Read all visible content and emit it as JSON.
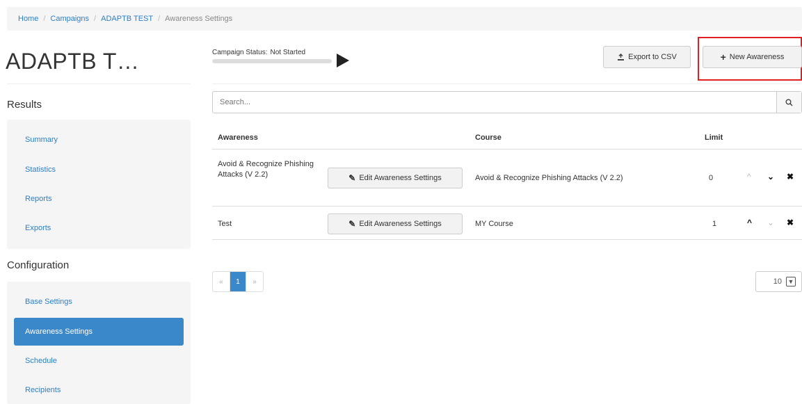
{
  "breadcrumb": {
    "home": "Home",
    "campaigns": "Campaigns",
    "campaign": "ADAPTB TEST",
    "current": "Awareness Settings",
    "separator": "/"
  },
  "page_title": "ADAPTB T…",
  "campaign_status": {
    "label": "Campaign Status:",
    "value": "Not Started"
  },
  "toolbar": {
    "export_label": "Export to CSV",
    "new_label": "New Awareness"
  },
  "sidebar": {
    "results_title": "Results",
    "results_items": [
      "Summary",
      "Statistics",
      "Reports",
      "Exports"
    ],
    "config_title": "Configuration",
    "config_items": [
      "Base Settings",
      "Awareness Settings",
      "Schedule",
      "Recipients"
    ],
    "active_item": "Awareness Settings"
  },
  "search": {
    "placeholder": "Search..."
  },
  "table": {
    "headers": {
      "awareness": "Awareness",
      "course": "Course",
      "limit": "Limit"
    },
    "edit_label": "Edit Awareness Settings",
    "rows": [
      {
        "awareness": "Avoid & Recognize Phishing Attacks (V 2.2)",
        "course": "Avoid & Recognize Phishing Attacks (V 2.2)",
        "limit": "0"
      },
      {
        "awareness": "Test",
        "course": "MY Course",
        "limit": "1"
      }
    ]
  },
  "pagination": {
    "prev": "«",
    "current": "1",
    "next": "»"
  },
  "page_size": {
    "value": "10"
  },
  "colors": {
    "accent": "#3a87c9",
    "link": "#2a7fc9",
    "highlight": "#e02020"
  }
}
